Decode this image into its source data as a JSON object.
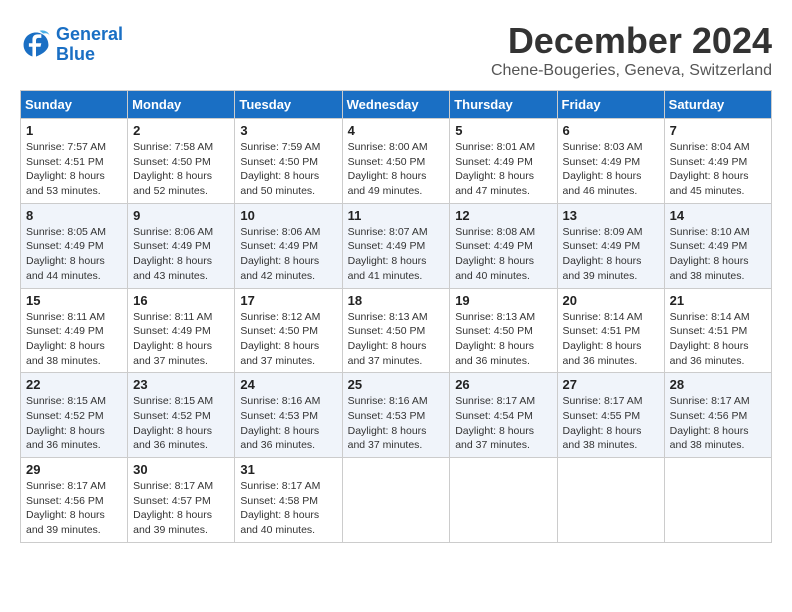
{
  "logo": {
    "line1": "General",
    "line2": "Blue"
  },
  "title": "December 2024",
  "location": "Chene-Bougeries, Geneva, Switzerland",
  "days_of_week": [
    "Sunday",
    "Monday",
    "Tuesday",
    "Wednesday",
    "Thursday",
    "Friday",
    "Saturday"
  ],
  "weeks": [
    [
      {
        "day": "1",
        "sunrise": "7:57 AM",
        "sunset": "4:51 PM",
        "daylight": "8 hours and 53 minutes."
      },
      {
        "day": "2",
        "sunrise": "7:58 AM",
        "sunset": "4:50 PM",
        "daylight": "8 hours and 52 minutes."
      },
      {
        "day": "3",
        "sunrise": "7:59 AM",
        "sunset": "4:50 PM",
        "daylight": "8 hours and 50 minutes."
      },
      {
        "day": "4",
        "sunrise": "8:00 AM",
        "sunset": "4:50 PM",
        "daylight": "8 hours and 49 minutes."
      },
      {
        "day": "5",
        "sunrise": "8:01 AM",
        "sunset": "4:49 PM",
        "daylight": "8 hours and 47 minutes."
      },
      {
        "day": "6",
        "sunrise": "8:03 AM",
        "sunset": "4:49 PM",
        "daylight": "8 hours and 46 minutes."
      },
      {
        "day": "7",
        "sunrise": "8:04 AM",
        "sunset": "4:49 PM",
        "daylight": "8 hours and 45 minutes."
      }
    ],
    [
      {
        "day": "8",
        "sunrise": "8:05 AM",
        "sunset": "4:49 PM",
        "daylight": "8 hours and 44 minutes."
      },
      {
        "day": "9",
        "sunrise": "8:06 AM",
        "sunset": "4:49 PM",
        "daylight": "8 hours and 43 minutes."
      },
      {
        "day": "10",
        "sunrise": "8:06 AM",
        "sunset": "4:49 PM",
        "daylight": "8 hours and 42 minutes."
      },
      {
        "day": "11",
        "sunrise": "8:07 AM",
        "sunset": "4:49 PM",
        "daylight": "8 hours and 41 minutes."
      },
      {
        "day": "12",
        "sunrise": "8:08 AM",
        "sunset": "4:49 PM",
        "daylight": "8 hours and 40 minutes."
      },
      {
        "day": "13",
        "sunrise": "8:09 AM",
        "sunset": "4:49 PM",
        "daylight": "8 hours and 39 minutes."
      },
      {
        "day": "14",
        "sunrise": "8:10 AM",
        "sunset": "4:49 PM",
        "daylight": "8 hours and 38 minutes."
      }
    ],
    [
      {
        "day": "15",
        "sunrise": "8:11 AM",
        "sunset": "4:49 PM",
        "daylight": "8 hours and 38 minutes."
      },
      {
        "day": "16",
        "sunrise": "8:11 AM",
        "sunset": "4:49 PM",
        "daylight": "8 hours and 37 minutes."
      },
      {
        "day": "17",
        "sunrise": "8:12 AM",
        "sunset": "4:50 PM",
        "daylight": "8 hours and 37 minutes."
      },
      {
        "day": "18",
        "sunrise": "8:13 AM",
        "sunset": "4:50 PM",
        "daylight": "8 hours and 37 minutes."
      },
      {
        "day": "19",
        "sunrise": "8:13 AM",
        "sunset": "4:50 PM",
        "daylight": "8 hours and 36 minutes."
      },
      {
        "day": "20",
        "sunrise": "8:14 AM",
        "sunset": "4:51 PM",
        "daylight": "8 hours and 36 minutes."
      },
      {
        "day": "21",
        "sunrise": "8:14 AM",
        "sunset": "4:51 PM",
        "daylight": "8 hours and 36 minutes."
      }
    ],
    [
      {
        "day": "22",
        "sunrise": "8:15 AM",
        "sunset": "4:52 PM",
        "daylight": "8 hours and 36 minutes."
      },
      {
        "day": "23",
        "sunrise": "8:15 AM",
        "sunset": "4:52 PM",
        "daylight": "8 hours and 36 minutes."
      },
      {
        "day": "24",
        "sunrise": "8:16 AM",
        "sunset": "4:53 PM",
        "daylight": "8 hours and 36 minutes."
      },
      {
        "day": "25",
        "sunrise": "8:16 AM",
        "sunset": "4:53 PM",
        "daylight": "8 hours and 37 minutes."
      },
      {
        "day": "26",
        "sunrise": "8:17 AM",
        "sunset": "4:54 PM",
        "daylight": "8 hours and 37 minutes."
      },
      {
        "day": "27",
        "sunrise": "8:17 AM",
        "sunset": "4:55 PM",
        "daylight": "8 hours and 38 minutes."
      },
      {
        "day": "28",
        "sunrise": "8:17 AM",
        "sunset": "4:56 PM",
        "daylight": "8 hours and 38 minutes."
      }
    ],
    [
      {
        "day": "29",
        "sunrise": "8:17 AM",
        "sunset": "4:56 PM",
        "daylight": "8 hours and 39 minutes."
      },
      {
        "day": "30",
        "sunrise": "8:17 AM",
        "sunset": "4:57 PM",
        "daylight": "8 hours and 39 minutes."
      },
      {
        "day": "31",
        "sunrise": "8:17 AM",
        "sunset": "4:58 PM",
        "daylight": "8 hours and 40 minutes."
      },
      null,
      null,
      null,
      null
    ]
  ]
}
